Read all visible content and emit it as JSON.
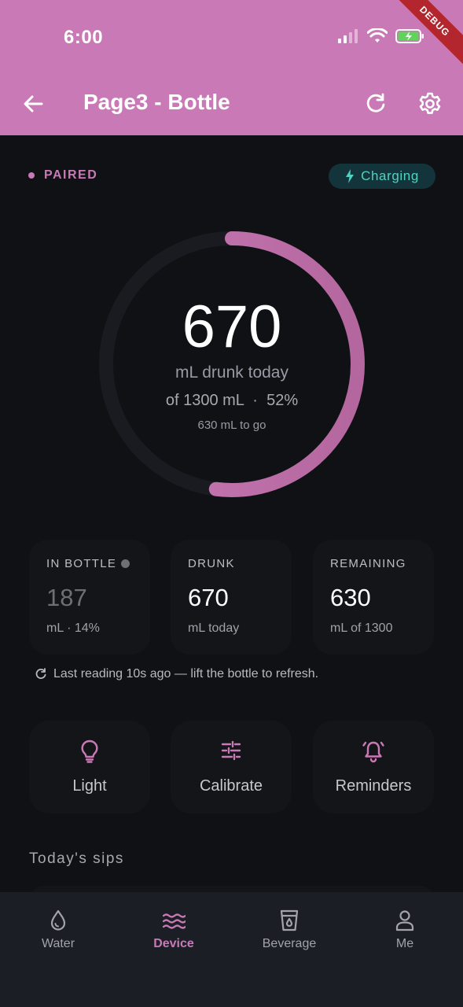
{
  "status_bar": {
    "time": "6:00"
  },
  "debug_banner": "DEBUG",
  "app_bar": {
    "title": "Page3 - Bottle",
    "back_icon": "arrow-back-icon",
    "refresh_icon": "refresh-icon",
    "settings_icon": "gear-icon"
  },
  "device": {
    "paired_label": "PAIRED",
    "charging_label": "Charging"
  },
  "progress": {
    "drunk": "670",
    "unit_line": "mL drunk today",
    "of_line": "of 1300 mL",
    "percent": "52%",
    "to_go": "630 mL to go",
    "fraction": 0.52
  },
  "stats": [
    {
      "label": "IN BOTTLE",
      "value": "187",
      "sub": "mL  ·  14%"
    },
    {
      "label": "DRUNK",
      "value": "670",
      "sub": "mL today"
    },
    {
      "label": "REMAINING",
      "value": "630",
      "sub": "mL of 1300"
    }
  ],
  "last_reading": "Last reading 10s ago — lift the bottle to refresh.",
  "actions": [
    {
      "label": "Light",
      "icon": "lightbulb-icon"
    },
    {
      "label": "Calibrate",
      "icon": "sliders-icon"
    },
    {
      "label": "Reminders",
      "icon": "alarm-bell-icon"
    }
  ],
  "sips_title": "Today's sips",
  "nav": [
    {
      "label": "Water",
      "icon": "water-drop-icon"
    },
    {
      "label": "Device",
      "icon": "waves-icon"
    },
    {
      "label": "Beverage",
      "icon": "cup-icon"
    },
    {
      "label": "Me",
      "icon": "person-icon"
    }
  ],
  "colors": {
    "accent": "#c97ab6",
    "background": "#0f1115",
    "charging": "#52d1c0"
  }
}
